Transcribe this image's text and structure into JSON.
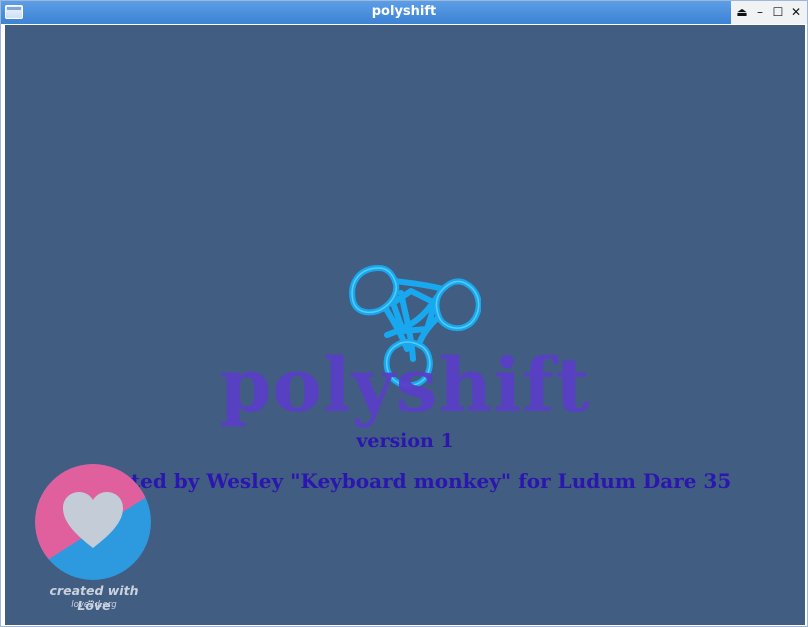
{
  "window": {
    "title": "polyshift",
    "controls": {
      "eject_icon": "⏏",
      "minimize_icon": "–",
      "maximize_icon": "☐",
      "close_icon": "✕"
    }
  },
  "game": {
    "title": "polyshift",
    "version": "version 1",
    "credits": "Created by Wesley \"Keyboard monkey\" for Ludum Dare 35",
    "logo_icon": "celtic-knot-icon",
    "colors": {
      "background": "#425d82",
      "title": "#5a3fc6",
      "text": "#2b16b0",
      "logo": "#18a8f0"
    }
  },
  "love_badge": {
    "text": "created with Löve",
    "url": "love2d.org",
    "colors": {
      "pink": "#e0609e",
      "blue": "#2d9ae0",
      "heart": "#c4ccd8"
    }
  }
}
